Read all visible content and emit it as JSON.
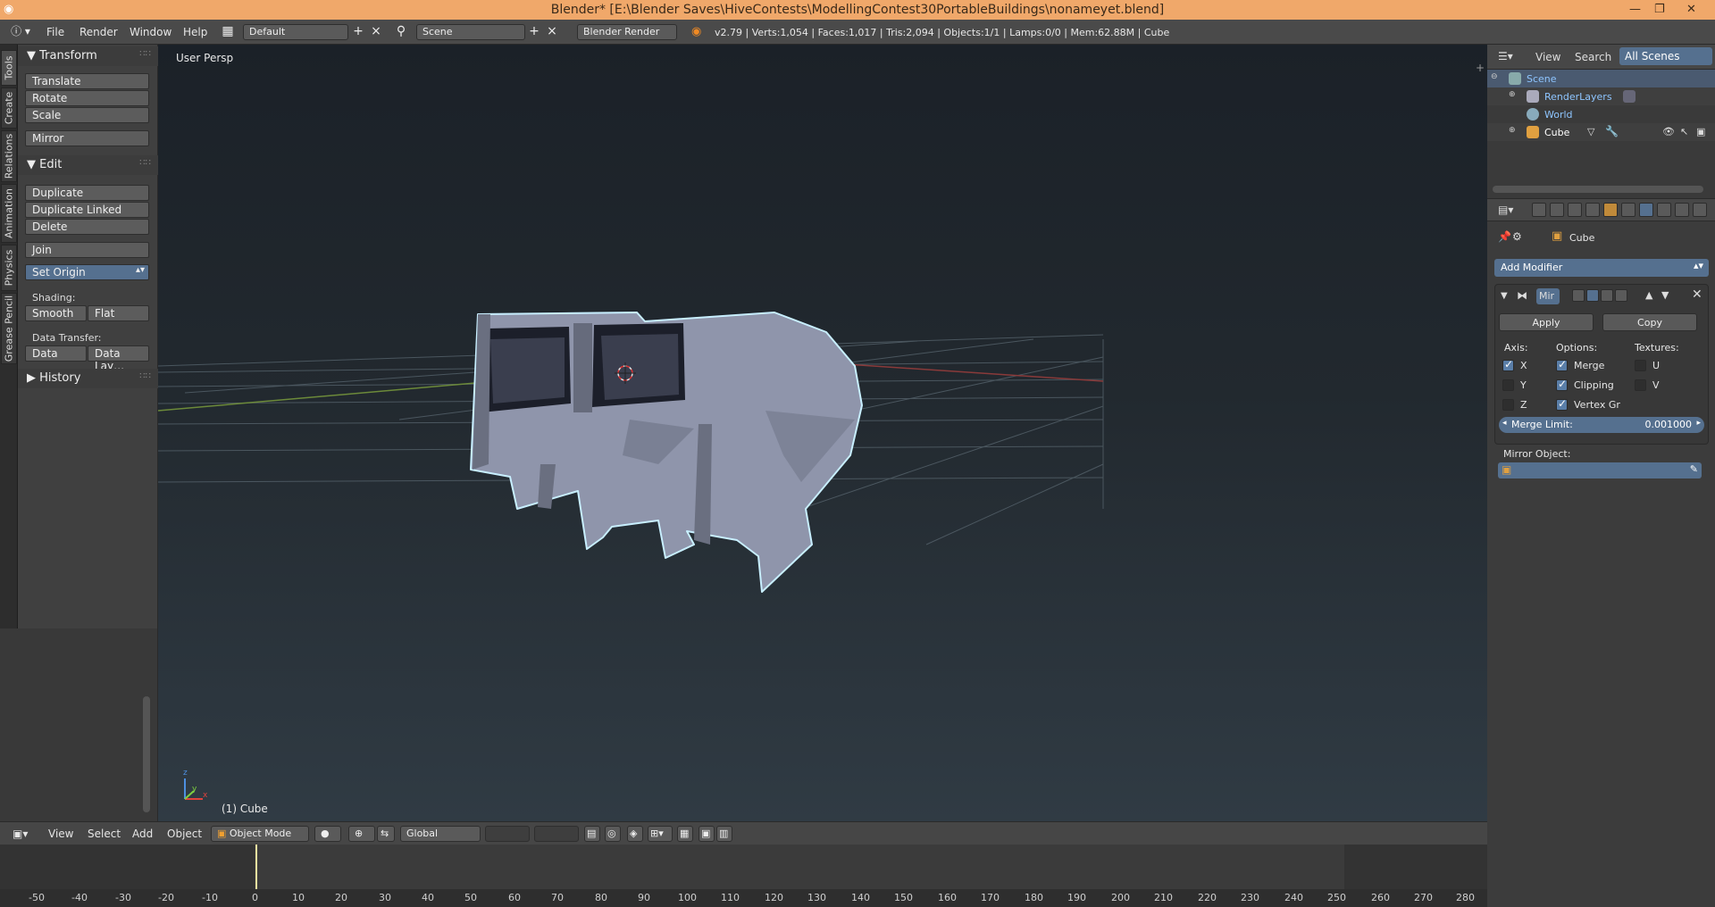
{
  "titlebar": {
    "text": "Blender* [E:\\Blender Saves\\HiveContests\\ModellingContest30PortableBuildings\\nonameyet.blend]",
    "minimize": "—",
    "maximize": "❐",
    "close": "✕"
  },
  "menubar": {
    "menus": [
      "File",
      "Render",
      "Window",
      "Help"
    ],
    "layout": "Default",
    "scene": "Scene",
    "engine": "Blender Render",
    "stats": "v2.79 | Verts:1,054 | Faces:1,017 | Tris:2,094 | Objects:1/1 | Lamps:0/0 | Mem:62.88M | Cube"
  },
  "vtabs": [
    "Tools",
    "Create",
    "Relations",
    "Animation",
    "Physics",
    "Grease Pencil"
  ],
  "toolshelf": {
    "transform_title": "Transform",
    "translate": "Translate",
    "rotate": "Rotate",
    "scale": "Scale",
    "mirror": "Mirror",
    "edit_title": "Edit",
    "duplicate": "Duplicate",
    "duplicate_linked": "Duplicate Linked",
    "delete": "Delete",
    "join": "Join",
    "set_origin": "Set Origin",
    "shading_label": "Shading:",
    "smooth": "Smooth",
    "flat": "Flat",
    "data_transfer_label": "Data Transfer:",
    "data": "Data",
    "data_layout": "Data Lay…",
    "history_title": "History"
  },
  "viewport": {
    "view_label": "User Persp",
    "object_label": "(1) Cube"
  },
  "vpheader": {
    "view": "View",
    "select": "Select",
    "add": "Add",
    "object": "Object",
    "mode": "Object Mode",
    "orientation": "Global"
  },
  "timeline": {
    "ticks": [
      "-50",
      "-40",
      "-30",
      "-20",
      "-10",
      "0",
      "10",
      "20",
      "30",
      "40",
      "50",
      "60",
      "70",
      "80",
      "90",
      "100",
      "110",
      "120",
      "130",
      "140",
      "150",
      "160",
      "170",
      "180",
      "190",
      "200",
      "210",
      "220",
      "230",
      "240",
      "250",
      "260",
      "270",
      "280"
    ]
  },
  "outliner": {
    "view": "View",
    "search": "Search",
    "filter": "All Scenes",
    "rows": [
      "Scene",
      "RenderLayers",
      "World",
      "Cube"
    ]
  },
  "properties": {
    "object_name": "Cube",
    "add_modifier": "Add Modifier",
    "modifier_name": "Mir",
    "apply": "Apply",
    "copy": "Copy",
    "axis_label": "Axis:",
    "options_label": "Options:",
    "textures_label": "Textures:",
    "axis_x": "X",
    "axis_y": "Y",
    "axis_z": "Z",
    "merge": "Merge",
    "clipping": "Clipping",
    "vertex_groups": "Vertex Gr",
    "tex_u": "U",
    "tex_v": "V",
    "merge_limit_label": "Merge Limit:",
    "merge_limit_value": "0.001000",
    "mirror_object_label": "Mirror Object:"
  },
  "colors": {
    "title_bar": "#f0a86a",
    "selection_blue": "#55708f",
    "outline_highlight": "#bfe8ff"
  }
}
